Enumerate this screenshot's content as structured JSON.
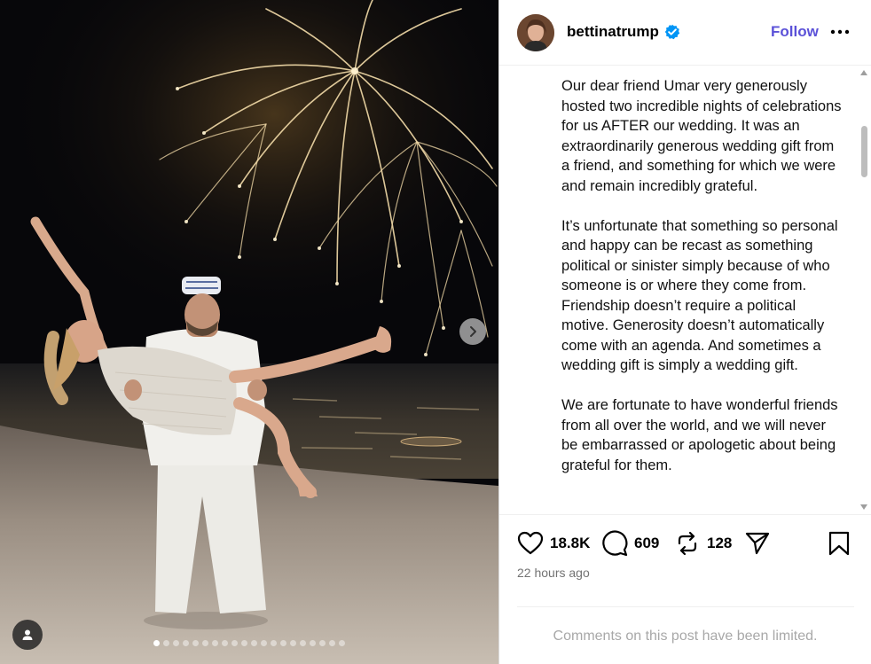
{
  "header": {
    "username": "bettinatrump",
    "follow_label": "Follow",
    "verified_icon": "verified-badge-icon",
    "more_icon": "more-options-icon"
  },
  "caption": {
    "text": "Our dear friend Umar very generously hosted two incredible nights of celebrations for us AFTER our wedding. It was an extraordinarily generous wedding gift from a friend, and something for which we were and remain incredibly grateful.\n\nIt’s unfortunate that something so personal and happy can be recast as something political or sinister simply because of who someone is or where they come from. Friendship doesn’t require a political motive. Generosity doesn’t automatically come with an agenda. And sometimes a wedding gift is simply a wedding gift.\n\nWe are fortunate to have wonderful friends from all over the world, and we will never be embarrassed or apologetic about being grateful for them."
  },
  "actions": {
    "likes": "18.8K",
    "comments": "609",
    "reposts": "128",
    "icons": [
      "heart-icon",
      "comment-icon",
      "repost-icon",
      "share-icon",
      "save-icon"
    ]
  },
  "meta": {
    "time_ago": "22 hours ago",
    "comments_limited": "Comments on this post have been limited."
  },
  "carousel": {
    "total_slides": 20,
    "active_index": 0
  },
  "colors": {
    "follow": "#5b51d8",
    "muted": "#737373",
    "divider": "#efefef"
  }
}
